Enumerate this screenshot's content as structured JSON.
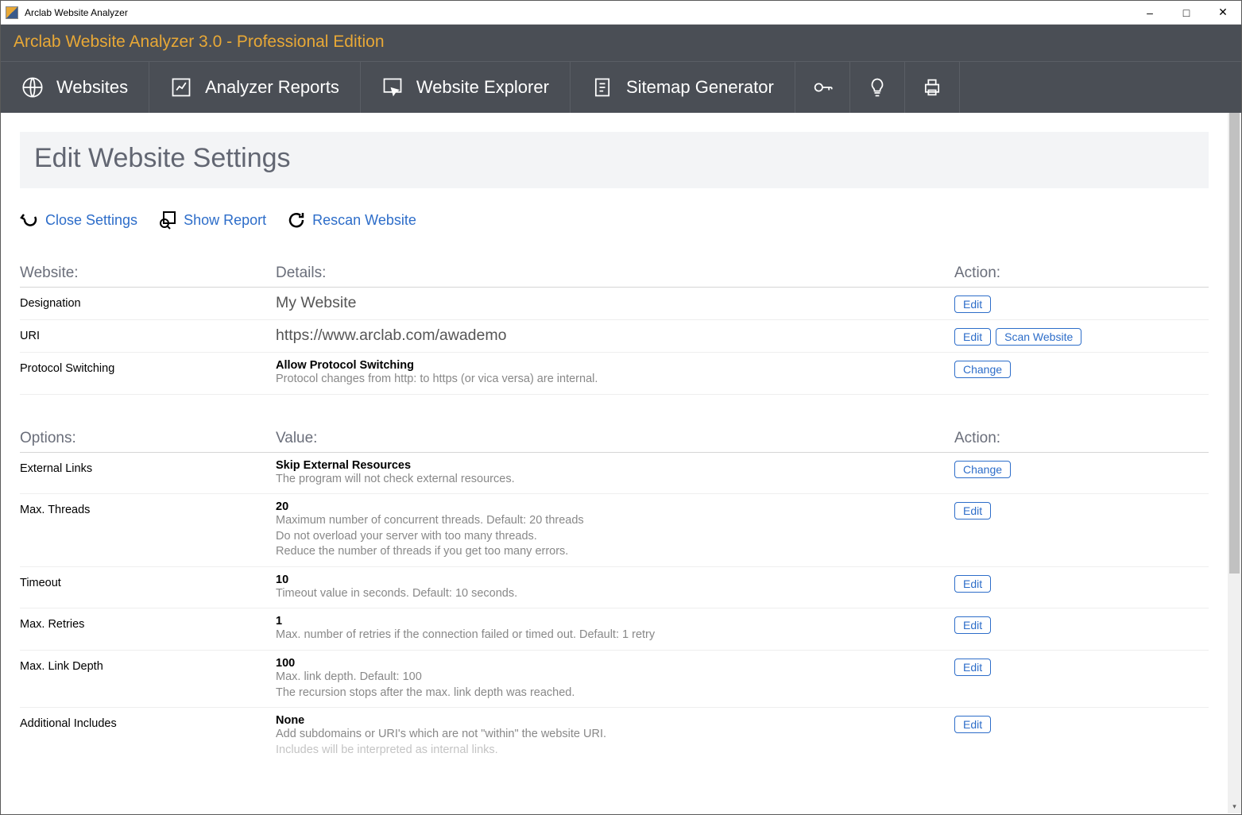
{
  "titlebar": {
    "text": "Arclab Website Analyzer"
  },
  "subheader": {
    "text": "Arclab Website Analyzer 3.0 - Professional Edition"
  },
  "toolbar": {
    "websites": "Websites",
    "reports": "Analyzer Reports",
    "explorer": "Website Explorer",
    "sitemap": "Sitemap Generator"
  },
  "page": {
    "title": "Edit Website Settings",
    "actions": {
      "close": "Close Settings",
      "report": "Show Report",
      "rescan": "Rescan Website"
    }
  },
  "headers1": {
    "c1": "Website:",
    "c2": "Details:",
    "c3": "Action:"
  },
  "headers2": {
    "c1": "Options:",
    "c2": "Value:",
    "c3": "Action:"
  },
  "buttons": {
    "edit": "Edit",
    "change": "Change",
    "scan": "Scan Website"
  },
  "website": {
    "designation": {
      "label": "Designation",
      "value": "My Website"
    },
    "uri": {
      "label": "URI",
      "value": "https://www.arclab.com/awademo"
    },
    "protocol": {
      "label": "Protocol Switching",
      "value": "Allow Protocol Switching",
      "desc": "Protocol changes from http: to https (or vica versa) are internal."
    }
  },
  "options": {
    "extlinks": {
      "label": "External Links",
      "value": "Skip External Resources",
      "desc": "The program will not check external resources."
    },
    "threads": {
      "label": "Max. Threads",
      "value": "20",
      "d1": "Maximum number of concurrent threads. Default: 20 threads",
      "d2": "Do not overload your server with too many threads.",
      "d3": "Reduce the number of threads if you get too many errors."
    },
    "timeout": {
      "label": "Timeout",
      "value": "10",
      "desc": "Timeout value in seconds. Default: 10 seconds."
    },
    "retries": {
      "label": "Max. Retries",
      "value": "1",
      "desc": "Max. number of retries if the connection failed or timed out. Default: 1 retry"
    },
    "depth": {
      "label": "Max. Link Depth",
      "value": "100",
      "d1": "Max. link depth. Default: 100",
      "d2": "The recursion stops after the max. link depth was reached."
    },
    "includes": {
      "label": "Additional Includes",
      "value": "None",
      "d1": "Add subdomains or URI's which are not \"within\" the website URI.",
      "d2": "Includes will be interpreted as internal links."
    }
  }
}
